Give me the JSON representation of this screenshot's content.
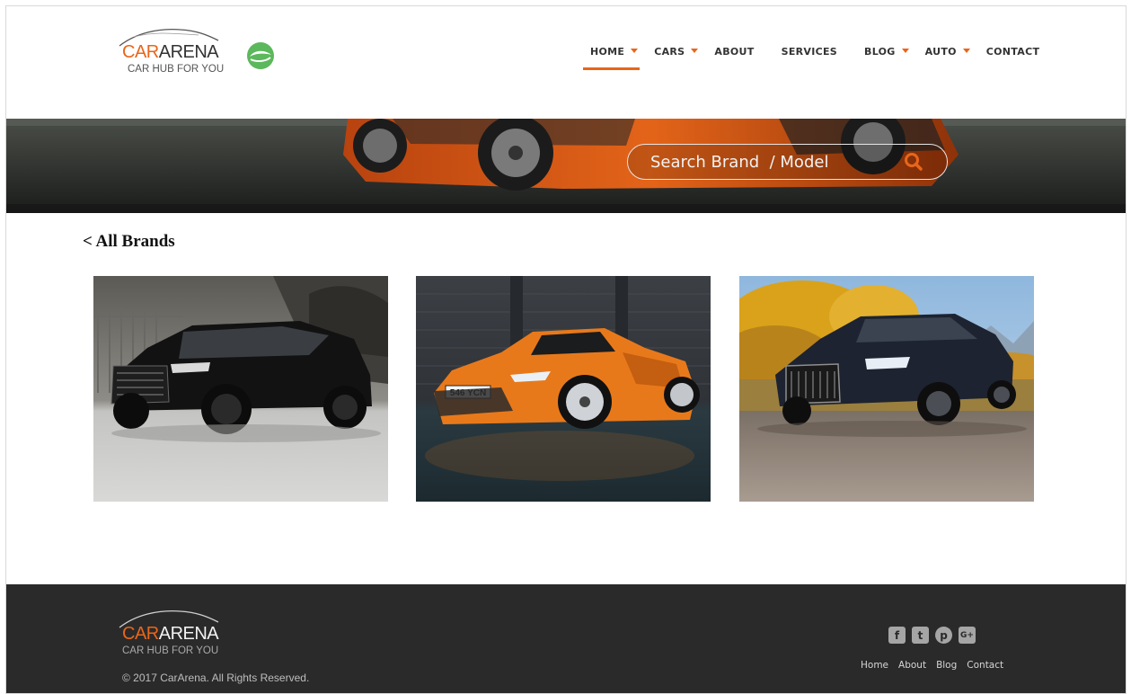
{
  "brand": {
    "title_car": "CAR",
    "title_rest": "ARENA",
    "tagline": "CAR HUB FOR YOU"
  },
  "nav": {
    "items": [
      {
        "label": "HOME",
        "dropdown": true,
        "active": true
      },
      {
        "label": "CARS",
        "dropdown": true,
        "active": false
      },
      {
        "label": "ABOUT",
        "dropdown": false,
        "active": false
      },
      {
        "label": "SERVICES",
        "dropdown": false,
        "active": false
      },
      {
        "label": "BLOG",
        "dropdown": true,
        "active": false
      },
      {
        "label": "AUTO",
        "dropdown": true,
        "active": false
      },
      {
        "label": "CONTACT",
        "dropdown": false,
        "active": false
      }
    ]
  },
  "search": {
    "placeholder": "Search Brand  / Model"
  },
  "main": {
    "back_link": "< All Brands",
    "cards": [
      {
        "subject": "black SUV",
        "plate": ""
      },
      {
        "subject": "orange sports car",
        "plate": "546 YCN"
      },
      {
        "subject": "dark blue wagon",
        "plate": ""
      }
    ]
  },
  "footer": {
    "copyright": "© 2017 CarArena. All Rights Reserved.",
    "social": [
      {
        "icon": "facebook-icon",
        "glyph": "f"
      },
      {
        "icon": "twitter-icon",
        "glyph": "t"
      },
      {
        "icon": "pinterest-icon",
        "glyph": "p"
      },
      {
        "icon": "google-plus-icon",
        "glyph": "G+"
      }
    ],
    "links": [
      "Home",
      "About",
      "Blog",
      "Contact"
    ]
  },
  "colors": {
    "accent": "#e8661b",
    "footer_bg": "#2a2a2a",
    "logo_badge": "#5cb85c"
  }
}
